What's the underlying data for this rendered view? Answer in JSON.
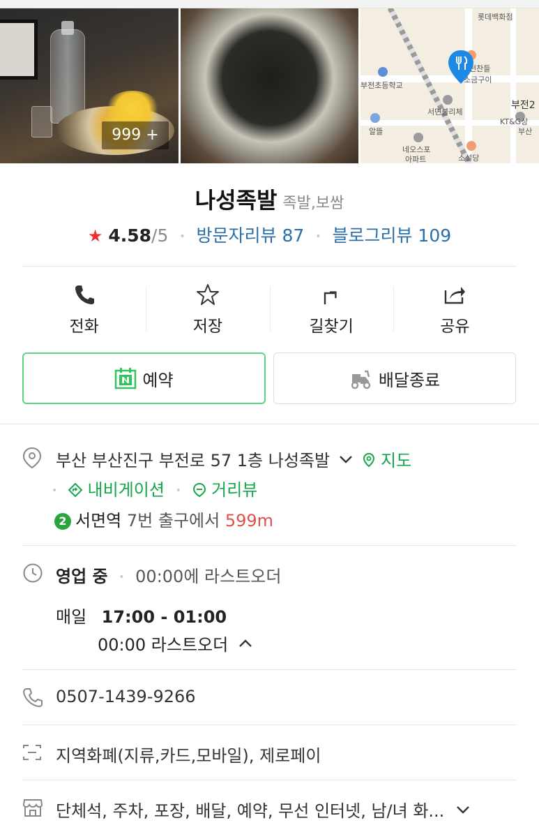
{
  "photos": {
    "count_label": "999 +"
  },
  "map": {
    "labels": [
      "롯데백화점",
      "부전초등학교",
      "서면블리체",
      "알뜰",
      "네오스포",
      "아파트",
      "소설당",
      "부전2",
      "KT&G상",
      "부산",
      "소금구이",
      "전찬들"
    ]
  },
  "place": {
    "name": "나성족발",
    "category": "족발,보쌈",
    "rating_star": "★",
    "rating": "4.58",
    "rating_max": "/5",
    "visitor_reviews": "방문자리뷰 87",
    "blog_reviews": "블로그리뷰 109"
  },
  "actions": [
    {
      "label": "전화",
      "icon": "phone-icon"
    },
    {
      "label": "저장",
      "icon": "star-icon"
    },
    {
      "label": "길찾기",
      "icon": "directions-icon"
    },
    {
      "label": "공유",
      "icon": "share-icon"
    }
  ],
  "buttons": {
    "reserve": "예약",
    "delivery": "배달종료"
  },
  "address": {
    "text": "부산 부산진구 부전로 57 1층 나성족발",
    "map_link": "지도",
    "navigation_link": "내비게이션",
    "streetview_link": "거리뷰",
    "subway_line": "2",
    "station": "서면역",
    "exit": "7번 출구에서",
    "distance": "599m"
  },
  "hours": {
    "status": "영업 중",
    "last_order_note": "00:00에 라스트오더",
    "day": "매일",
    "time": "17:00 - 01:00",
    "last_order": "00:00 라스트오더"
  },
  "phone": "0507-1439-9266",
  "payment": "지역화폐(지류,카드,모바일), 제로페이",
  "amenities": "단체석, 주차, 포장, 배달, 예약, 무선 인터넷, 남/녀 화...",
  "colors": {
    "accent_green": "#15a54b",
    "link_blue": "#2b6ea8",
    "distance_red": "#e0504e",
    "star_red": "#ef2f2f",
    "pin_blue": "#1e88e5"
  }
}
